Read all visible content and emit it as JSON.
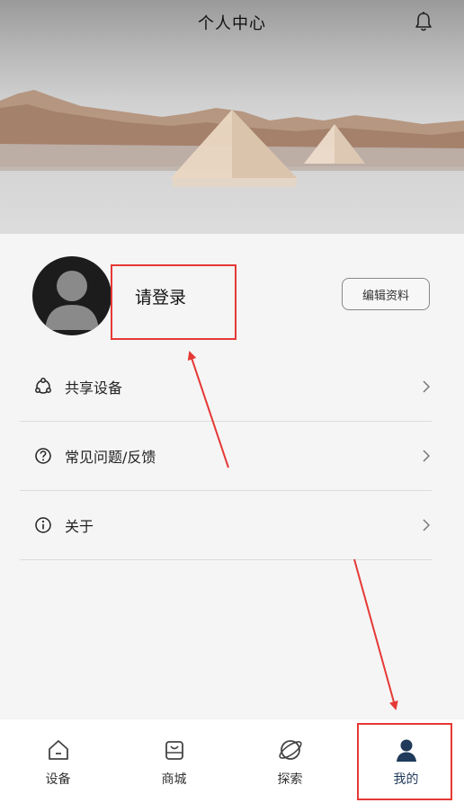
{
  "header": {
    "title": "个人中心",
    "notification_icon": "bell-icon"
  },
  "profile": {
    "login_text": "请登录",
    "edit_button_label": "编辑资料",
    "avatar_icon": "default-avatar-icon"
  },
  "menu": [
    {
      "label": "共享设备",
      "icon": "share-icon"
    },
    {
      "label": "常见问题/反馈",
      "icon": "question-icon"
    },
    {
      "label": "关于",
      "icon": "info-icon"
    }
  ],
  "bottom_nav": [
    {
      "label": "设备",
      "icon": "home-icon",
      "active": false
    },
    {
      "label": "商城",
      "icon": "shopping-bag-icon",
      "active": false
    },
    {
      "label": "探索",
      "icon": "explore-icon",
      "active": false
    },
    {
      "label": "我的",
      "icon": "user-icon",
      "active": true
    }
  ],
  "colors": {
    "annotation_red": "#e53935",
    "active_tab": "#1f3a5a",
    "background": "#f5f5f5"
  }
}
